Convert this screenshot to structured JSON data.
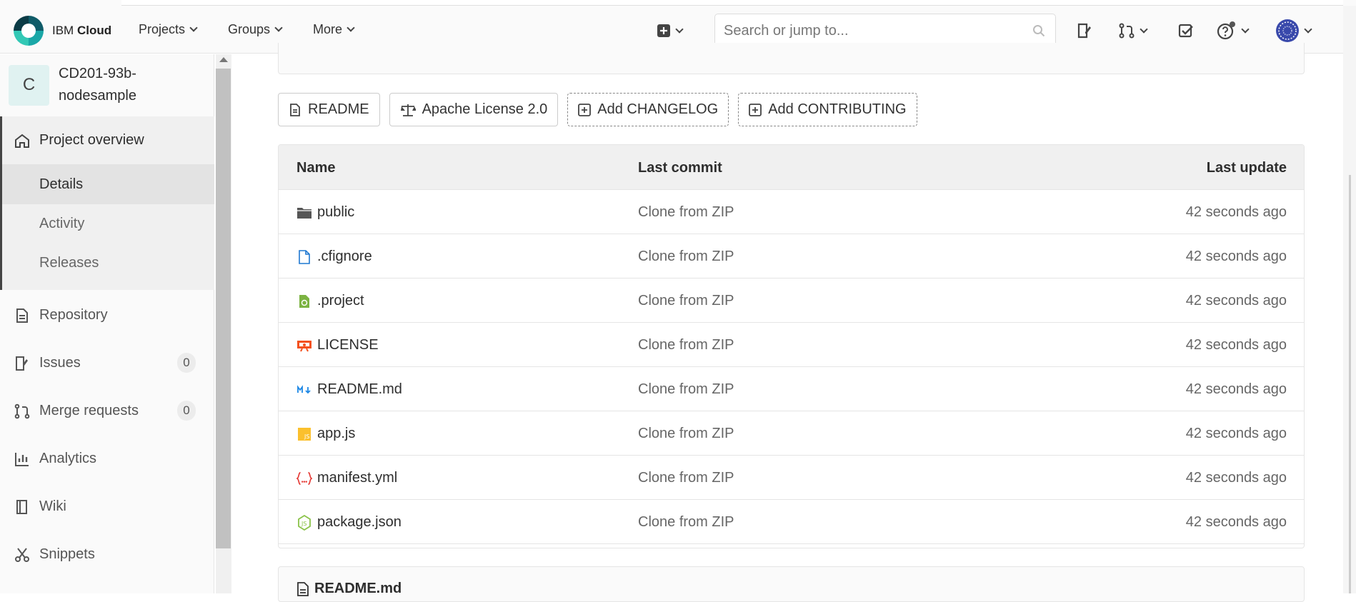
{
  "header": {
    "brand_light": "IBM",
    "brand_bold": "Cloud",
    "nav": [
      "Projects",
      "Groups",
      "More"
    ],
    "search_placeholder": "Search or jump to..."
  },
  "sidebar": {
    "project_initial": "C",
    "project_name": "CD201-93b-nodesample",
    "overview_label": "Project overview",
    "sub_items": [
      "Details",
      "Activity",
      "Releases"
    ],
    "items": [
      {
        "label": "Repository",
        "icon": "document-icon"
      },
      {
        "label": "Issues",
        "icon": "issues-icon",
        "badge": "0"
      },
      {
        "label": "Merge requests",
        "icon": "merge-request-icon",
        "badge": "0"
      },
      {
        "label": "Analytics",
        "icon": "chart-icon"
      },
      {
        "label": "Wiki",
        "icon": "book-icon"
      },
      {
        "label": "Snippets",
        "icon": "scissors-icon"
      }
    ]
  },
  "quick_buttons": [
    "README",
    "Apache License 2.0",
    "Add CHANGELOG",
    "Add CONTRIBUTING"
  ],
  "table": {
    "headers": {
      "name": "Name",
      "last_commit": "Last commit",
      "last_update": "Last update"
    },
    "rows": [
      {
        "name": "public",
        "icon": "folder-icon",
        "commit": "Clone from ZIP",
        "updated": "42 seconds ago"
      },
      {
        "name": ".cfignore",
        "icon": "file-icon",
        "commit": "Clone from ZIP",
        "updated": "42 seconds ago"
      },
      {
        "name": ".project",
        "icon": "project-file-icon",
        "commit": "Clone from ZIP",
        "updated": "42 seconds ago"
      },
      {
        "name": "LICENSE",
        "icon": "license-icon",
        "commit": "Clone from ZIP",
        "updated": "42 seconds ago"
      },
      {
        "name": "README.md",
        "icon": "markdown-icon",
        "commit": "Clone from ZIP",
        "updated": "42 seconds ago"
      },
      {
        "name": "app.js",
        "icon": "javascript-icon",
        "commit": "Clone from ZIP",
        "updated": "42 seconds ago"
      },
      {
        "name": "manifest.yml",
        "icon": "yaml-icon",
        "commit": "Clone from ZIP",
        "updated": "42 seconds ago"
      },
      {
        "name": "package.json",
        "icon": "nodejs-icon",
        "commit": "Clone from ZIP",
        "updated": "42 seconds ago"
      }
    ]
  },
  "readme_header": "README.md",
  "colors": {
    "active_section_bg": "#f0f0f0",
    "selected_sub_bg": "#e3e3e3",
    "badge_bg": "#ececec"
  }
}
